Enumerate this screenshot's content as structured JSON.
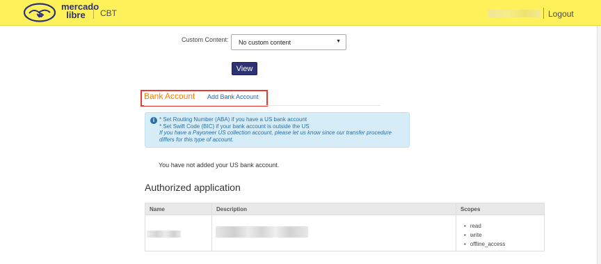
{
  "header": {
    "logo_text": "mercado libre",
    "brand": "CBT",
    "logout_label": "Logout",
    "colors": {
      "bar": "#fff159",
      "logo_text": "#2d3277"
    }
  },
  "custom_content": {
    "label": "Custom Content:",
    "selected": "No custom content"
  },
  "view_button": {
    "label": "View"
  },
  "bank_account": {
    "title": "Bank Account",
    "add_link": "Add Bank Account",
    "info_lines": [
      "* Set Routing Number (ABA) if you have a US bank account",
      "* Set Swift Code (BIC) if your bank account is outside the US",
      "If you have a Payoneer US collection account, please let us know since our transfer procedure",
      "differs for this type of account."
    ],
    "notice": "You have not added your US bank account."
  },
  "authorized_application": {
    "title": "Authorized application",
    "columns": [
      "Name",
      "Description",
      "Scopes"
    ],
    "scopes": [
      "read",
      "write",
      "offline_access"
    ]
  }
}
